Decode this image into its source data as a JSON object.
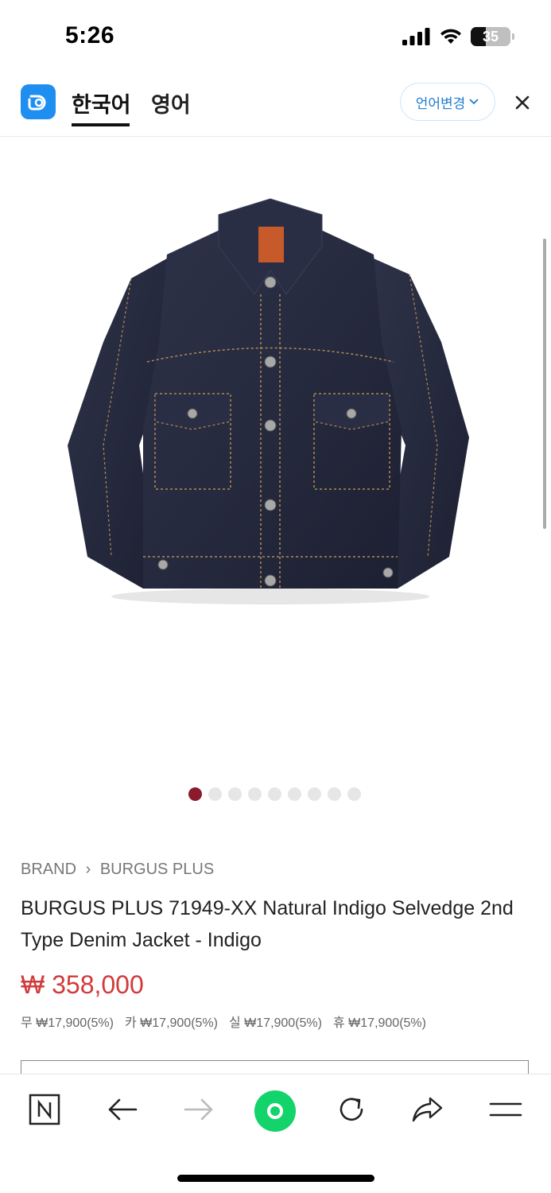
{
  "status_bar": {
    "time": "5:26",
    "battery_level": "35",
    "icons": [
      "cellular-signal-icon",
      "wifi-icon",
      "battery-icon"
    ]
  },
  "translate_bar": {
    "source_lang": "한국어",
    "target_lang": "영어",
    "change_lang_label": "언어변경",
    "accent_color": "#1e8ff0"
  },
  "carousel": {
    "total_slides": 9,
    "active_index": 0,
    "active_color": "#8a1a2c"
  },
  "product": {
    "breadcrumb_root": "BRAND",
    "breadcrumb_brand": "BURGUS PLUS",
    "title": "BURGUS PLUS 71949-XX Natural Indigo Selvedge 2nd Type Denim Jacket - Indigo",
    "price": "₩ 358,000",
    "price_color": "#d13a3a",
    "discounts": [
      "무 ₩17,900(5%)",
      "카 ₩17,900(5%)",
      "실 ₩17,900(5%)",
      "휴 ₩17,900(5%)"
    ]
  },
  "browser_bar": {
    "buttons": [
      "naver-n-icon",
      "back-arrow-icon",
      "forward-arrow-icon",
      "home-green-icon",
      "reload-icon",
      "share-icon",
      "menu-icon"
    ]
  }
}
